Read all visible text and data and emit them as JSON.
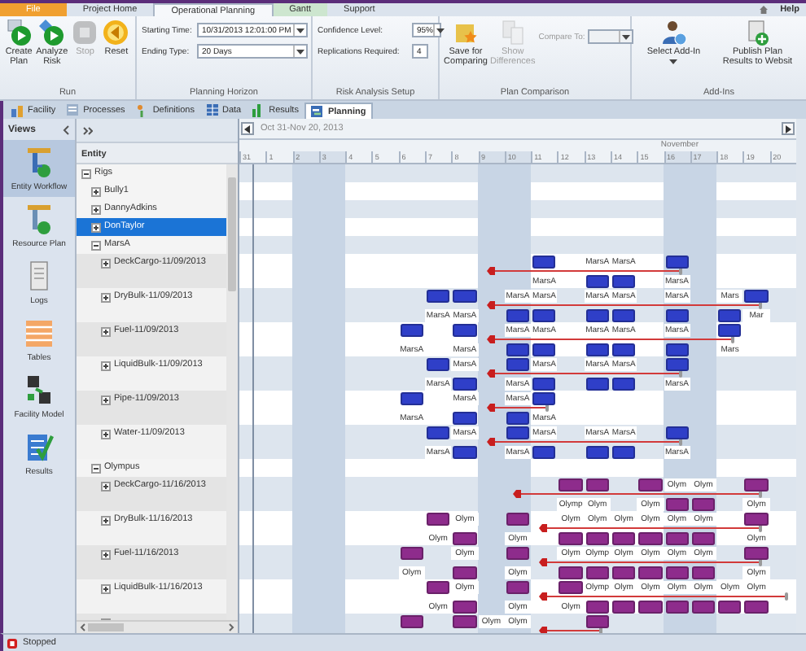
{
  "ribbon": {
    "tabs": [
      {
        "label": "File",
        "kind": "file",
        "selected": false
      },
      {
        "label": "Project Home",
        "kind": "normal",
        "selected": false
      },
      {
        "label": "Operational Planning",
        "kind": "normal",
        "selected": true
      },
      {
        "label": "Gantt",
        "kind": "context",
        "selected": false
      },
      {
        "label": "Support",
        "kind": "normal",
        "selected": false
      }
    ],
    "help": "Help",
    "groups": [
      {
        "title": "Run",
        "kind": "buttons",
        "buttons": [
          {
            "label": "Create Plan",
            "disabled": false
          },
          {
            "label": "Analyze Risk",
            "disabled": false
          },
          {
            "label": "Stop",
            "disabled": true
          },
          {
            "label": "Reset",
            "disabled": false
          }
        ]
      },
      {
        "title": "Planning Horizon",
        "kind": "fields",
        "fields": [
          {
            "label": "Starting Time:",
            "value": "10/31/2013 12:01:00 PM",
            "dropdown": true
          },
          {
            "label": "Ending Type:",
            "value": "20 Days",
            "dropdown": true
          }
        ]
      },
      {
        "title": "Risk Analysis Setup",
        "kind": "fields",
        "fields": [
          {
            "label": "Confidence Level:",
            "value": "95%",
            "dropdown": true
          },
          {
            "label": "Replications Required:",
            "value": "4",
            "dropdown": false
          }
        ]
      },
      {
        "title": "Plan Comparison",
        "kind": "compare",
        "buttons": [
          {
            "label": "Save for Comparing",
            "disabled": false
          },
          {
            "label": "Show Differences",
            "disabled": true
          }
        ],
        "compare_label": "Compare To:",
        "compare_disabled": true
      },
      {
        "title": "Add-Ins",
        "kind": "buttons",
        "buttons": [
          {
            "label": "Select Add-In",
            "disabled": false,
            "menu": true
          },
          {
            "label": "Publish Plan Results to Websit",
            "disabled": false
          }
        ]
      }
    ]
  },
  "doc_tabs": [
    {
      "label": "Facility",
      "selected": false
    },
    {
      "label": "Processes",
      "selected": false
    },
    {
      "label": "Definitions",
      "selected": false
    },
    {
      "label": "Data",
      "selected": false
    },
    {
      "label": "Results",
      "selected": false
    },
    {
      "label": "Planning",
      "selected": true
    }
  ],
  "views": {
    "title": "Views",
    "items": [
      {
        "label": "Entity Workflow",
        "selected": true
      },
      {
        "label": "Resource Plan",
        "selected": false
      },
      {
        "label": "Logs",
        "selected": false
      },
      {
        "label": "Tables",
        "selected": false
      },
      {
        "label": "Facility Model",
        "selected": false
      },
      {
        "label": "Results",
        "selected": false
      }
    ]
  },
  "entity_tree": {
    "header": "Entity",
    "items": [
      {
        "name": "Rigs",
        "expanded": true,
        "selected": false,
        "children": [
          {
            "name": "Bully1",
            "expanded": false,
            "selected": false
          },
          {
            "name": "DannyAdkins",
            "expanded": false,
            "selected": false
          },
          {
            "name": "DonTaylor",
            "expanded": false,
            "selected": true
          },
          {
            "name": "MarsA",
            "expanded": true,
            "selected": false,
            "color": "#2f3fc8",
            "children": [
              {
                "name": "DeckCargo-11/09/2013",
                "expanded": false,
                "selected": false,
                "cells": [
                  null,
                  null,
                  null,
                  null,
                  null,
                  null,
                  null,
                  null,
                  null,
                  {
                    "kind": "start"
                  },
                  null,
                  {
                    "kind": "top",
                    "label": "MarsA"
                  },
                  null,
                  {
                    "kind": "bottom",
                    "label": "MarsA"
                  },
                  {
                    "kind": "bottom",
                    "label": "MarsA"
                  },
                  null,
                  {
                    "kind": "finish",
                    "label": "MarsA"
                  }
                ]
              },
              {
                "name": "DryBulk-11/09/2013",
                "expanded": false,
                "selected": false,
                "cells": [
                  null,
                  null,
                  null,
                  null,
                  null,
                  null,
                  null,
                  {
                    "kind": "top",
                    "label": "MarsA"
                  },
                  {
                    "kind": "top",
                    "label": "MarsA"
                  },
                  {
                    "kind": "start"
                  },
                  {
                    "kind": "bottom",
                    "label": "MarsA"
                  },
                  {
                    "kind": "bottom",
                    "label": "MarsA"
                  },
                  null,
                  {
                    "kind": "bottom",
                    "label": "MarsA"
                  },
                  {
                    "kind": "bottom",
                    "label": "MarsA"
                  },
                  null,
                  {
                    "kind": "bottom",
                    "label": "MarsA"
                  },
                  null,
                  {
                    "kind": "bottom",
                    "label": "Mars"
                  },
                  {
                    "kind": "finish",
                    "label": "Mar"
                  }
                ]
              },
              {
                "name": "Fuel-11/09/2013",
                "expanded": false,
                "selected": false,
                "cells": [
                  null,
                  null,
                  null,
                  null,
                  null,
                  null,
                  {
                    "kind": "top",
                    "label": "MarsA"
                  },
                  null,
                  {
                    "kind": "top",
                    "label": "MarsA"
                  },
                  {
                    "kind": "start"
                  },
                  {
                    "kind": "bottom",
                    "label": "MarsA"
                  },
                  {
                    "kind": "bottom",
                    "label": "MarsA"
                  },
                  null,
                  {
                    "kind": "bottom",
                    "label": "MarsA"
                  },
                  {
                    "kind": "bottom",
                    "label": "MarsA"
                  },
                  null,
                  {
                    "kind": "bottom",
                    "label": "MarsA"
                  },
                  null,
                  {
                    "kind": "finish",
                    "label": "Mars"
                  }
                ]
              },
              {
                "name": "LiquidBulk-11/09/2013",
                "expanded": false,
                "selected": false,
                "cells": [
                  null,
                  null,
                  null,
                  null,
                  null,
                  null,
                  null,
                  {
                    "kind": "top",
                    "label": "MarsA"
                  },
                  {
                    "kind": "bottom",
                    "label": "MarsA"
                  },
                  {
                    "kind": "start"
                  },
                  {
                    "kind": "top",
                    "label": "MarsA"
                  },
                  {
                    "kind": "bottom",
                    "label": "MarsA"
                  },
                  null,
                  {
                    "kind": "bottom",
                    "label": "MarsA"
                  },
                  {
                    "kind": "bottom",
                    "label": "MarsA"
                  },
                  null,
                  {
                    "kind": "finish",
                    "label": "MarsA"
                  }
                ]
              },
              {
                "name": "Pipe-11/09/2013",
                "expanded": false,
                "selected": false,
                "cells": [
                  null,
                  null,
                  null,
                  null,
                  null,
                  null,
                  {
                    "kind": "top",
                    "label": "MarsA"
                  },
                  null,
                  {
                    "kind": "bottom",
                    "label": "MarsA"
                  },
                  {
                    "kind": "start"
                  },
                  {
                    "kind": "bottom",
                    "label": "MarsA"
                  },
                  {
                    "kind": "finish",
                    "label": "MarsA"
                  }
                ]
              },
              {
                "name": "Water-11/09/2013",
                "expanded": false,
                "selected": false,
                "cells": [
                  null,
                  null,
                  null,
                  null,
                  null,
                  null,
                  null,
                  {
                    "kind": "top",
                    "label": "MarsA"
                  },
                  {
                    "kind": "bottom",
                    "label": "MarsA"
                  },
                  {
                    "kind": "start"
                  },
                  {
                    "kind": "top",
                    "label": "MarsA"
                  },
                  {
                    "kind": "bottom",
                    "label": "MarsA"
                  },
                  null,
                  {
                    "kind": "bottom",
                    "label": "MarsA"
                  },
                  {
                    "kind": "bottom",
                    "label": "MarsA"
                  },
                  null,
                  {
                    "kind": "finish",
                    "label": "MarsA"
                  }
                ]
              }
            ]
          },
          {
            "name": "Olympus",
            "expanded": true,
            "selected": false,
            "color": "#8e2c8c",
            "children": [
              {
                "name": "DeckCargo-11/16/2013",
                "expanded": false,
                "selected": false,
                "cells": [
                  null,
                  null,
                  null,
                  null,
                  null,
                  null,
                  null,
                  null,
                  null,
                  null,
                  {
                    "kind": "start"
                  },
                  null,
                  {
                    "kind": "top",
                    "label": "Olymp"
                  },
                  {
                    "kind": "top",
                    "label": "Olym"
                  },
                  null,
                  {
                    "kind": "top",
                    "label": "Olym"
                  },
                  {
                    "kind": "bottom",
                    "label": "Olym"
                  },
                  {
                    "kind": "bottom",
                    "label": "Olym"
                  },
                  null,
                  {
                    "kind": "finish",
                    "label": "Olym"
                  }
                ]
              },
              {
                "name": "DryBulk-11/16/2013",
                "expanded": false,
                "selected": false,
                "cells": [
                  null,
                  null,
                  null,
                  null,
                  null,
                  null,
                  null,
                  {
                    "kind": "top",
                    "label": "Olym"
                  },
                  {
                    "kind": "bottom",
                    "label": "Olym"
                  },
                  null,
                  {
                    "kind": "top",
                    "label": "Olym"
                  },
                  {
                    "kind": "start"
                  },
                  {
                    "kind": "bottom",
                    "label": "Olym"
                  },
                  {
                    "kind": "bottom",
                    "label": "Olym"
                  },
                  {
                    "kind": "bottom",
                    "label": "Olym"
                  },
                  {
                    "kind": "bottom",
                    "label": "Olym"
                  },
                  {
                    "kind": "bottom",
                    "label": "Olym"
                  },
                  {
                    "kind": "bottom",
                    "label": "Olym"
                  },
                  null,
                  {
                    "kind": "finish",
                    "label": "Olym"
                  }
                ]
              },
              {
                "name": "Fuel-11/16/2013",
                "expanded": false,
                "selected": false,
                "cells": [
                  null,
                  null,
                  null,
                  null,
                  null,
                  null,
                  {
                    "kind": "top",
                    "label": "Olym"
                  },
                  null,
                  {
                    "kind": "bottom",
                    "label": "Olym"
                  },
                  null,
                  {
                    "kind": "top",
                    "label": "Olym"
                  },
                  {
                    "kind": "start"
                  },
                  {
                    "kind": "bottom",
                    "label": "Olym"
                  },
                  {
                    "kind": "bottom",
                    "label": "Olymp"
                  },
                  {
                    "kind": "bottom",
                    "label": "Olym"
                  },
                  {
                    "kind": "bottom",
                    "label": "Olym"
                  },
                  {
                    "kind": "bottom",
                    "label": "Olym"
                  },
                  {
                    "kind": "bottom",
                    "label": "Olym"
                  },
                  null,
                  {
                    "kind": "finish",
                    "label": "Olym"
                  }
                ]
              },
              {
                "name": "LiquidBulk-11/16/2013",
                "expanded": false,
                "selected": false,
                "cells": [
                  null,
                  null,
                  null,
                  null,
                  null,
                  null,
                  null,
                  {
                    "kind": "top",
                    "label": "Olym"
                  },
                  {
                    "kind": "bottom",
                    "label": "Olym"
                  },
                  null,
                  {
                    "kind": "top",
                    "label": "Olym"
                  },
                  {
                    "kind": "start"
                  },
                  {
                    "kind": "top",
                    "label": "Olym"
                  },
                  {
                    "kind": "bottom",
                    "label": "Olymp"
                  },
                  {
                    "kind": "bottom",
                    "label": "Olym"
                  },
                  {
                    "kind": "bottom",
                    "label": "Olym"
                  },
                  {
                    "kind": "bottom",
                    "label": "Olym"
                  },
                  {
                    "kind": "bottom",
                    "label": "Olym"
                  },
                  {
                    "kind": "bottom",
                    "label": "Olym"
                  },
                  {
                    "kind": "bottom",
                    "label": "Olym"
                  },
                  {
                    "kind": "end"
                  }
                ]
              },
              {
                "expanded": false,
                "selected": false,
                "cells": [
                  null,
                  null,
                  null,
                  null,
                  null,
                  null,
                  {
                    "kind": "top"
                  },
                  null,
                  {
                    "kind": "top"
                  },
                  {
                    "kind": "bottom",
                    "label": "Olym"
                  },
                  {
                    "kind": "bottom",
                    "label": "Olym"
                  },
                  {
                    "kind": "start"
                  },
                  null,
                  {
                    "kind": "finish"
                  }
                ]
              }
            ]
          }
        ]
      }
    ]
  },
  "gantt": {
    "range": "Oct 31-Nov 20, 2013",
    "month": "November",
    "days": [
      {
        "label": "31",
        "weekend": false
      },
      {
        "label": "1",
        "weekend": false
      },
      {
        "label": "2",
        "weekend": true
      },
      {
        "label": "3",
        "weekend": true
      },
      {
        "label": "4",
        "weekend": false
      },
      {
        "label": "5",
        "weekend": false
      },
      {
        "label": "6",
        "weekend": false
      },
      {
        "label": "7",
        "weekend": false
      },
      {
        "label": "8",
        "weekend": false
      },
      {
        "label": "9",
        "weekend": true
      },
      {
        "label": "10",
        "weekend": true
      },
      {
        "label": "11",
        "weekend": false
      },
      {
        "label": "12",
        "weekend": false
      },
      {
        "label": "13",
        "weekend": false
      },
      {
        "label": "14",
        "weekend": false
      },
      {
        "label": "15",
        "weekend": false
      },
      {
        "label": "16",
        "weekend": true
      },
      {
        "label": "17",
        "weekend": true
      },
      {
        "label": "18",
        "weekend": false
      },
      {
        "label": "19",
        "weekend": false
      },
      {
        "label": "20",
        "weekend": false
      }
    ]
  },
  "status_bar": {
    "text": "Stopped"
  }
}
